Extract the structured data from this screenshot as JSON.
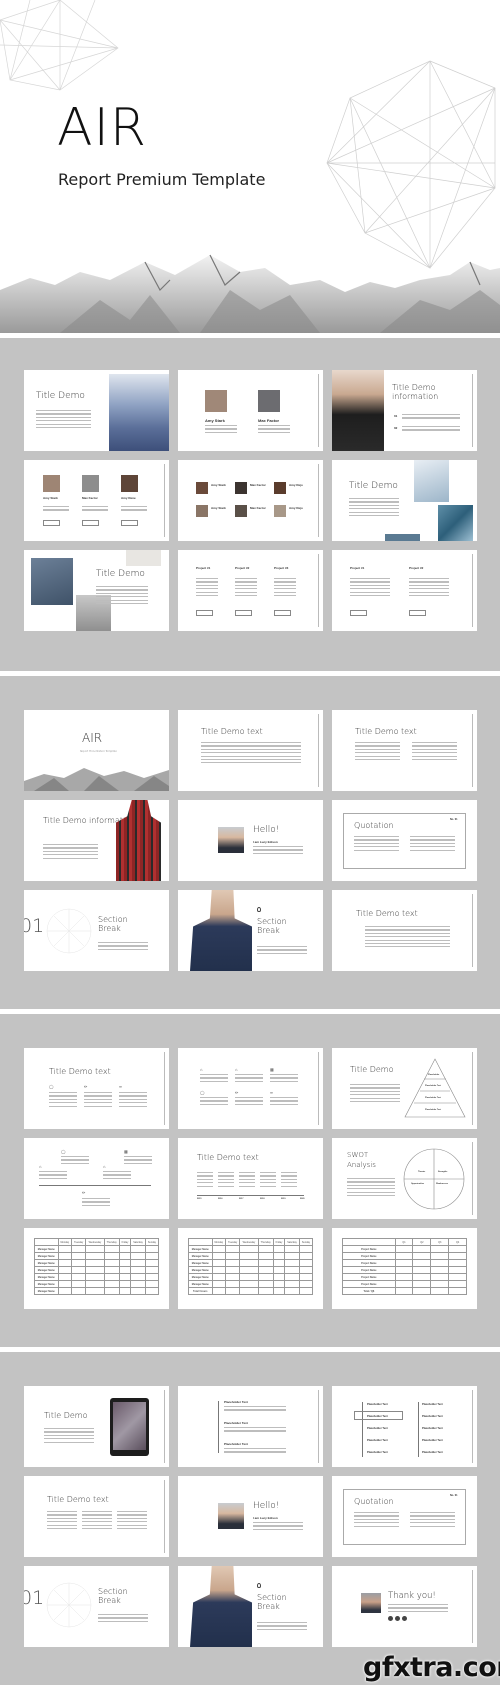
{
  "hero": {
    "title": "AIR",
    "subtitle": "Report Premium Template"
  },
  "sections": [
    {
      "slides": [
        {
          "type": "title-image",
          "title": "Title Demo"
        },
        {
          "type": "team-2",
          "people": [
            {
              "name": "Amy Stark"
            },
            {
              "name": "Max Factor"
            }
          ]
        },
        {
          "type": "title-info-photo",
          "title": "Title Demo information",
          "items": [
            "01",
            "02"
          ]
        },
        {
          "type": "team-3",
          "people": [
            {
              "name": "Amy Stark"
            },
            {
              "name": "Max Factor"
            },
            {
              "name": "Amy Rene"
            }
          ],
          "button": "Read More"
        },
        {
          "type": "team-6",
          "people": [
            {
              "name": "Amy Stark"
            },
            {
              "name": "Max Factor"
            },
            {
              "name": "Amy Rejo"
            },
            {
              "name": "Amy Stark"
            },
            {
              "name": "Max Factor"
            },
            {
              "name": "Amy Rejo"
            }
          ]
        },
        {
          "type": "title-images-right",
          "title": "Title Demo"
        },
        {
          "type": "title-images-left",
          "title": "Title Demo"
        },
        {
          "type": "projects-3",
          "projects": [
            "Project #1",
            "Project #2",
            "Project #3"
          ],
          "button": "Read More"
        },
        {
          "type": "projects-2",
          "projects": [
            "Project #1",
            "Project #2"
          ],
          "button": "Read More"
        }
      ]
    },
    {
      "slides": [
        {
          "type": "cover",
          "title": "AIR",
          "subtitle": "Report Presentation Template"
        },
        {
          "type": "text-1col",
          "title": "Title Demo text"
        },
        {
          "type": "text-2col",
          "title": "Title Demo text"
        },
        {
          "type": "title-info-person",
          "title": "Title Demo information"
        },
        {
          "type": "hello",
          "title": "Hello!",
          "subtitle": "I am Lucy Edison"
        },
        {
          "type": "quotation",
          "title": "Quotation",
          "page": "No. 01"
        },
        {
          "type": "section-break",
          "number": "01",
          "title": "Section Break"
        },
        {
          "type": "section-break-photo",
          "title": "Section Break"
        },
        {
          "type": "text-block",
          "title": "Title Demo text"
        }
      ]
    },
    {
      "slides": [
        {
          "type": "icons-3",
          "title": "Title Demo text"
        },
        {
          "type": "icons-6"
        },
        {
          "type": "pyramid",
          "title": "Title Demo",
          "levels": [
            "Placeholder",
            "Placeholder Text",
            "Placeholder Text",
            "Placeholder Text"
          ]
        },
        {
          "type": "timeline-icons"
        },
        {
          "type": "timeline-years",
          "title": "Title Demo text",
          "years": [
            "2015",
            "2016",
            "2017",
            "2018",
            "2019",
            "2020"
          ]
        },
        {
          "type": "swot",
          "title": "SWOT Analysis",
          "quadrants": [
            "Threats",
            "Strengths",
            "Opportunities",
            "Weaknesses"
          ]
        },
        {
          "type": "schedule-table",
          "columns": [
            "",
            "Monday",
            "Tuesday",
            "Wednesday",
            "Thursday",
            "Friday",
            "Saturday",
            "Sunday"
          ],
          "row_label": "Manager Name",
          "rows": 7
        },
        {
          "type": "number-table",
          "columns": [
            "",
            "Monday",
            "Tuesday",
            "Wednesday",
            "Thursday",
            "Friday",
            "Saturday",
            "Sunday"
          ],
          "row_label": "Manager Name",
          "total_label": "Total / Hours",
          "rows": 6
        },
        {
          "type": "quarter-table",
          "columns": [
            "",
            "Q1",
            "Q2",
            "Q3",
            "Q4"
          ],
          "row_label": "Project Name",
          "total_label": "Total / Q$",
          "rows": 6
        }
      ]
    },
    {
      "slides": [
        {
          "type": "tablet",
          "title": "Title Demo"
        },
        {
          "type": "vtimeline",
          "items": [
            "Placeholder Text",
            "Placeholder Text",
            "Placeholder Text"
          ]
        },
        {
          "type": "vtimeline-2col",
          "items": [
            "Placeholder Text",
            "Placeholder Text",
            "Placeholder Text",
            "Placeholder Text",
            "Placeholder Text"
          ]
        },
        {
          "type": "text-3col",
          "title": "Title Demo text"
        },
        {
          "type": "hello",
          "title": "Hello!",
          "subtitle": "I am Lucy Edison"
        },
        {
          "type": "quotation",
          "title": "Quotation",
          "page": "No. 01"
        },
        {
          "type": "section-break",
          "number": "01",
          "title": "Section Break"
        },
        {
          "type": "section-break-photo",
          "title": "Section Break"
        },
        {
          "type": "thank-you",
          "title": "Thank you!",
          "social_icons": [
            "social-icon-1",
            "social-icon-2",
            "social-icon-3"
          ]
        }
      ]
    }
  ],
  "watermark": "gfxtra.com",
  "colors": {
    "background": "#c3c3c3",
    "slide": "#ffffff",
    "text": "#333333",
    "accent_blue": "#5b6f99"
  }
}
